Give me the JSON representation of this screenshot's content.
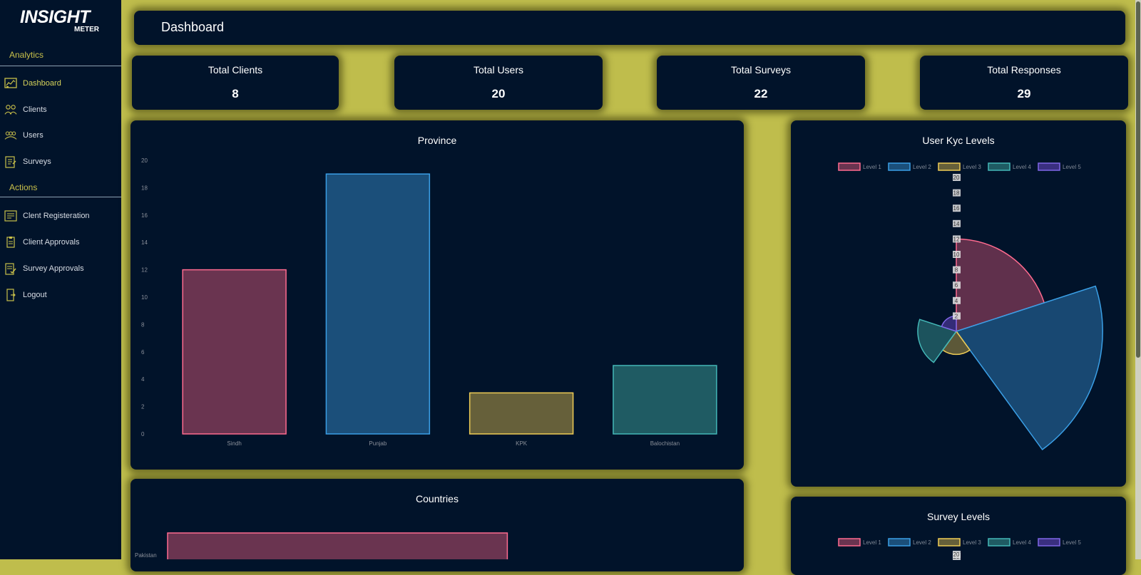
{
  "brand": {
    "name": "INSIGHT",
    "sub": "METER"
  },
  "sidebar": {
    "analytics_title": "Analytics",
    "actions_title": "Actions",
    "analytics": [
      {
        "label": "Dashboard",
        "icon": "dashboard-icon",
        "active": true
      },
      {
        "label": "Clients",
        "icon": "clients-icon"
      },
      {
        "label": "Users",
        "icon": "users-icon"
      },
      {
        "label": "Surveys",
        "icon": "surveys-icon"
      }
    ],
    "actions": [
      {
        "label": "Clent Registeration",
        "icon": "registration-icon"
      },
      {
        "label": "Client Approvals",
        "icon": "approval-icon"
      },
      {
        "label": "Survey Approvals",
        "icon": "survey-approval-icon"
      },
      {
        "label": "Logout",
        "icon": "logout-icon"
      }
    ]
  },
  "header": {
    "title": "Dashboard"
  },
  "stats": [
    {
      "label": "Total Clients",
      "value": "8"
    },
    {
      "label": "Total Users",
      "value": "20"
    },
    {
      "label": "Total Surveys",
      "value": "22"
    },
    {
      "label": "Total Responses",
      "value": "29"
    }
  ],
  "colors": {
    "accent": "#c9c04a",
    "background": "#bfbd4c",
    "panel": "#01132a",
    "series": [
      {
        "fill": "#6a3450",
        "stroke": "#ff6b8f"
      },
      {
        "fill": "#1b4f7a",
        "stroke": "#3a9fe6"
      },
      {
        "fill": "#66603a",
        "stroke": "#efcc55"
      },
      {
        "fill": "#1f5b63",
        "stroke": "#44b8b8"
      },
      {
        "fill": "#3a2f80",
        "stroke": "#7f66e6"
      }
    ]
  },
  "chart_data": [
    {
      "type": "bar",
      "title": "Province",
      "categories": [
        "Sindh",
        "Punjab",
        "KPK",
        "Balochistan"
      ],
      "values": [
        12,
        19,
        3,
        5
      ],
      "ylim": [
        0,
        20
      ],
      "yticks": [
        0,
        2,
        4,
        6,
        8,
        10,
        12,
        14,
        16,
        18,
        20
      ],
      "grid": false
    },
    {
      "type": "polarArea",
      "title": "User Kyc Levels",
      "categories": [
        "Level 1",
        "Level 2",
        "Level 3",
        "Level 4",
        "Level 5"
      ],
      "values": [
        12,
        19,
        3,
        5,
        2
      ],
      "rlim": [
        0,
        20
      ],
      "rticks": [
        0,
        2,
        4,
        6,
        8,
        10,
        12,
        14,
        16,
        18,
        20
      ],
      "legend": "top"
    },
    {
      "type": "bar",
      "orientation": "horizontal",
      "title": "Countries",
      "categories": [
        "Pakistan"
      ],
      "values": [
        12
      ]
    },
    {
      "type": "polarArea",
      "title": "Survey Levels",
      "categories": [
        "Level 1",
        "Level 2",
        "Level 3",
        "Level 4",
        "Level 5"
      ],
      "rticks": [
        20
      ],
      "legend": "top"
    }
  ]
}
